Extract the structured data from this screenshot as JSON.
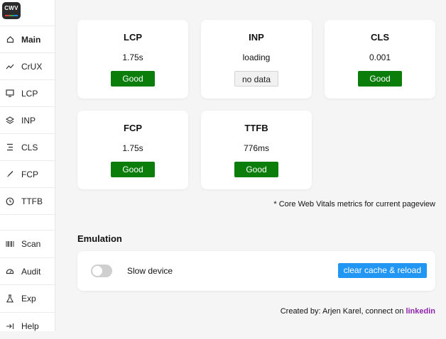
{
  "logo": {
    "text": "CWV"
  },
  "sidebar": {
    "items": [
      {
        "label": "Main",
        "active": true
      },
      {
        "label": "CrUX"
      },
      {
        "label": "LCP"
      },
      {
        "label": "INP"
      },
      {
        "label": "CLS"
      },
      {
        "label": "FCP"
      },
      {
        "label": "TTFB"
      },
      {
        "label": "Scan"
      },
      {
        "label": "Audit"
      },
      {
        "label": "Exp"
      },
      {
        "label": "Help"
      }
    ]
  },
  "metrics": [
    {
      "name": "LCP",
      "value": "1.75s",
      "status": "Good"
    },
    {
      "name": "INP",
      "value": "loading",
      "status": "no data"
    },
    {
      "name": "CLS",
      "value": "0.001",
      "status": "Good"
    },
    {
      "name": "FCP",
      "value": "1.75s",
      "status": "Good"
    },
    {
      "name": "TTFB",
      "value": "776ms",
      "status": "Good"
    }
  ],
  "note": "* Core Web Vitals metrics for current pageview",
  "emulation": {
    "title": "Emulation",
    "toggle_label": "Slow device",
    "toggle_on": false,
    "button_label": "clear cache & reload"
  },
  "footer": {
    "text": "Created by: Arjen Karel, connect on ",
    "link": "linkedin"
  },
  "colors": {
    "good": "#0a7d0a",
    "accent": "#2196f3",
    "link": "#8e24aa"
  }
}
